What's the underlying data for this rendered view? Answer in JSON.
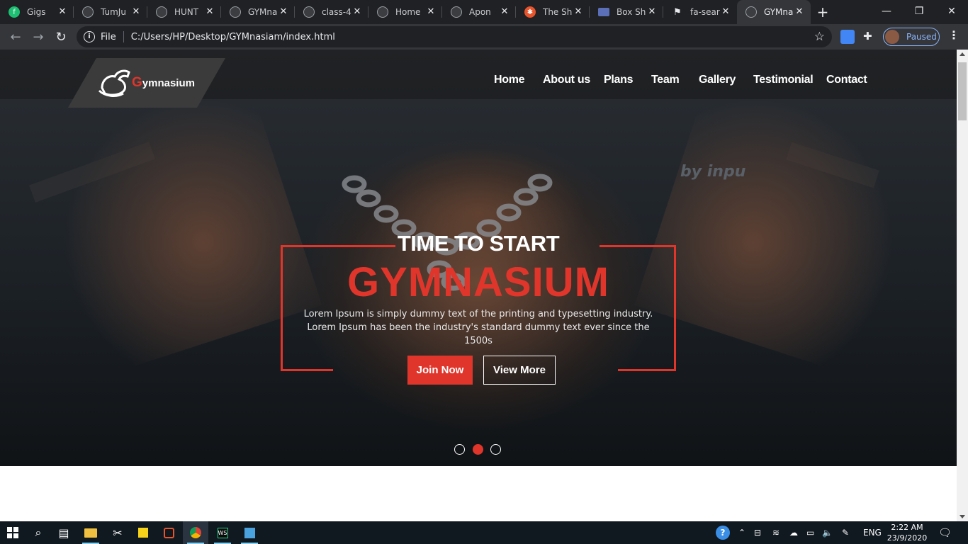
{
  "browser": {
    "tabs": [
      {
        "title": "Gigs",
        "favicon": "fiverr-icon"
      },
      {
        "title": "TumJu",
        "favicon": "globe-icon"
      },
      {
        "title": "HUNT",
        "favicon": "globe-icon"
      },
      {
        "title": "GYMna",
        "favicon": "globe-icon"
      },
      {
        "title": "class-4",
        "favicon": "globe-icon"
      },
      {
        "title": "Home",
        "favicon": "globe-icon"
      },
      {
        "title": "Apon",
        "favicon": "globe-icon"
      },
      {
        "title": "The Sh",
        "favicon": "orange-icon"
      },
      {
        "title": "Box Sh",
        "favicon": "box-icon"
      },
      {
        "title": "fa-sear",
        "favicon": "flag-icon"
      },
      {
        "title": "GYMna",
        "favicon": "globe-icon",
        "active": true
      }
    ],
    "address": {
      "scheme_label": "File",
      "url": "C:/Users/HP/Desktop/GYMnasiam/index.html"
    },
    "profile_label": "Paused"
  },
  "site": {
    "logo_initial": "G",
    "logo_rest": "ymnasium",
    "nav": [
      "Home",
      "About us",
      "Plans",
      "Team",
      "Gallery",
      "Testimonial",
      "Contact"
    ],
    "background_print": "by inpu",
    "hero": {
      "kicker": "TIME TO START",
      "headline": "GYMNASIUM",
      "lead": "Lorem Ipsum is simply dummy text of the printing and typesetting industry. Lorem Ipsum has been the industry's standard dummy text ever since the 1500s",
      "primary_cta": "Join Now",
      "secondary_cta": "View More",
      "slides": 3,
      "active_slide": 2
    },
    "colors": {
      "accent": "#e0352b",
      "nav_text": "#ffffff"
    }
  },
  "taskbar": {
    "language": "ENG",
    "time": "2:22 AM",
    "date": "23/9/2020"
  }
}
